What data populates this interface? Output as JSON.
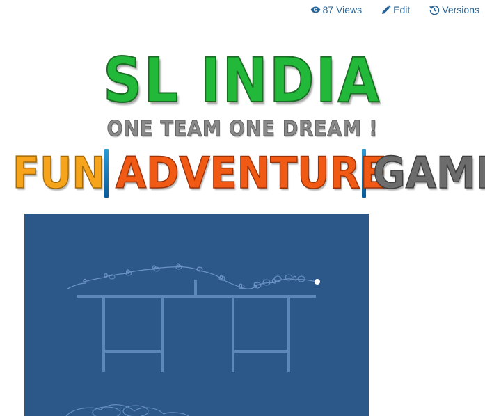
{
  "toolbar": {
    "views_label": "87 Views",
    "edit_label": "Edit",
    "versions_label": "Versions"
  },
  "banner": {
    "title": "SL INDIA",
    "subtitle": "ONE TEAM ONE DREAM !",
    "tagline": {
      "word1": "FUN",
      "word2": "ADVENTURE",
      "word3": "GAME"
    }
  },
  "colors": {
    "link": "#2a6496",
    "title_green": "#22b83a",
    "fun_orange": "#f5a41c",
    "adventure_orange": "#f05a14",
    "game_gray": "#6c6c6c",
    "divider_blue": "#1a7ac0",
    "canvas_bg": "#2c5889",
    "drawing_line": "#5d87b9"
  },
  "icons": {
    "views": "eye-icon",
    "edit": "pencil-icon",
    "versions": "history-icon"
  }
}
